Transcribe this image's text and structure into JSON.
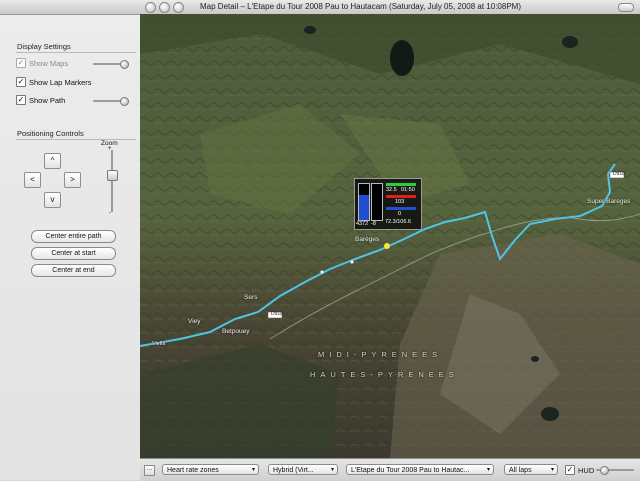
{
  "map_window": {
    "title": "Map Detail – L'Etape du Tour 2008 Pau to Hautacam  (Saturday, July 05, 2008 at 10:08PM)"
  },
  "display_settings": {
    "title": "Display Settings",
    "show_maps": {
      "label": "Show Maps",
      "checked": true,
      "enabled": false,
      "slider_level": 0.85
    },
    "show_lap_markers": {
      "label": "Show Lap Markers",
      "checked": true
    },
    "show_path": {
      "label": "Show Path",
      "checked": true,
      "slider_level": 0.85
    }
  },
  "positioning_controls": {
    "title": "Positioning Controls",
    "up_label": "^",
    "left_label": "<",
    "right_label": ">",
    "down_label": "v",
    "zoom_label": "Zoom",
    "zoom_plus": "+",
    "zoom_minus": "-",
    "zoom_level": 0.62,
    "center_entire_path": "Center entire path",
    "center_at_start": "Center at start",
    "center_at_end": "Center at end"
  },
  "map": {
    "labels": {
      "vley": "Viey",
      "sers": "Sers",
      "betpouey": "Betpouey",
      "bareges": "Barèges",
      "super_bareges": "Super Bareges",
      "road_d918_a": "D918",
      "road_d918_b": "D918",
      "region_1": "MIDI-PYRENEES",
      "region_2": "HAUTES-PYRENEES",
      "path_label": "Viella"
    },
    "path_color": "#4fc4e8"
  },
  "hud": {
    "left_value": "4372",
    "left_value2": "-8",
    "speed": "32.5",
    "time": "01:50",
    "hr": "103",
    "cadence": "0",
    "distance": "72.3/106.6",
    "colors": {
      "green": "#2ecc40",
      "red": "#e02020",
      "blue": "#2050d0"
    }
  },
  "bottom_bar": {
    "square_button": "...",
    "zones_select": "Heart rate zones",
    "map_type_select": "Hybrid (Virt...",
    "activity_select": "L'Etape du Tour 2008 Pau to Hautac...",
    "laps_select": "All laps",
    "hud_checkbox": {
      "label": "HUD",
      "checked": true
    },
    "hud_slider_level": 0.2
  }
}
